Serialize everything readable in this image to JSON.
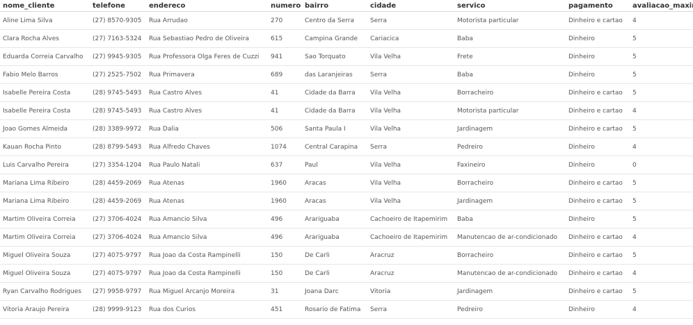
{
  "table": {
    "columns": [
      "nome_cliente",
      "telefone",
      "endereco",
      "numero",
      "bairro",
      "cidade",
      "servico",
      "pagamento",
      "avaliacao_maxima"
    ],
    "rows": [
      [
        "Aline Lima Silva",
        "(27) 8570-9305",
        "Rua Arrudao",
        "270",
        "Centro da Serra",
        "Serra",
        "Motorista particular",
        "Dinheiro e cartao",
        "4"
      ],
      [
        "Clara Rocha Alves",
        "(27) 7163-5324",
        "Rua Sebastiao Pedro de Oliveira",
        "615",
        "Campina Grande",
        "Cariacica",
        "Baba",
        "Dinheiro",
        "5"
      ],
      [
        "Eduarda Correia Carvalho",
        "(27) 9945-9305",
        "Rua Professora Olga Feres de Cuzzi",
        "941",
        "Sao Torquato",
        "Vila Velha",
        "Frete",
        "Dinheiro",
        "5"
      ],
      [
        "Fabio Melo Barros",
        "(27) 2525-7502",
        "Rua Primavera",
        "689",
        "das Laranjeiras",
        "Serra",
        "Baba",
        "Dinheiro",
        "5"
      ],
      [
        "Isabelle Pereira Costa",
        "(28) 9745-5493",
        "Rua Castro Alves",
        "41",
        "Cidade da Barra",
        "Vila Velha",
        "Borracheiro",
        "Dinheiro e cartao",
        "5"
      ],
      [
        "Isabelle Pereira Costa",
        "(28) 9745-5493",
        "Rua Castro Alves",
        "41",
        "Cidade da Barra",
        "Vila Velha",
        "Motorista particular",
        "Dinheiro e cartao",
        "4"
      ],
      [
        "Joao Gomes Almeida",
        "(28) 3389-9972",
        "Rua Dalia",
        "506",
        "Santa Paula I",
        "Vila Velha",
        "Jardinagem",
        "Dinheiro e cartao",
        "5"
      ],
      [
        "Kauan Rocha Pinto",
        "(28) 8799-5493",
        "Rua Alfredo Chaves",
        "1074",
        "Central Carapina",
        "Serra",
        "Pedreiro",
        "Dinheiro",
        "4"
      ],
      [
        "Luis Carvalho Pereira",
        "(27) 3354-1204",
        "Rua Paulo Natali",
        "637",
        "Paul",
        "Vila Velha",
        "Faxineiro",
        "Dinheiro",
        "0"
      ],
      [
        "Mariana Lima Ribeiro",
        "(28) 4459-2069",
        "Rua Atenas",
        "1960",
        "Aracas",
        "Vila Velha",
        "Borracheiro",
        "Dinheiro e cartao",
        "5"
      ],
      [
        "Mariana Lima Ribeiro",
        "(28) 4459-2069",
        "Rua Atenas",
        "1960",
        "Aracas",
        "Vila Velha",
        "Jardinagem",
        "Dinheiro e cartao",
        "5"
      ],
      [
        "Martim Oliveira Correia",
        "(27) 3706-4024",
        "Rua Amancio Silva",
        "496",
        "Arariguaba",
        "Cachoeiro de Itapemirim",
        "Baba",
        "Dinheiro",
        "5"
      ],
      [
        "Martim Oliveira Correia",
        "(27) 3706-4024",
        "Rua Amancio Silva",
        "496",
        "Arariguaba",
        "Cachoeiro de Itapemirim",
        "Manutencao de ar-condicionado",
        "Dinheiro e cartao",
        "4"
      ],
      [
        "Miguel Oliveira Souza",
        "(27) 4075-9797",
        "Rua Joao da Costa Rampinelli",
        "150",
        "De Carli",
        "Aracruz",
        "Borracheiro",
        "Dinheiro e cartao",
        "5"
      ],
      [
        "Miguel Oliveira Souza",
        "(27) 4075-9797",
        "Rua Joao da Costa Rampinelli",
        "150",
        "De Carli",
        "Aracruz",
        "Manutencao de ar-condicionado",
        "Dinheiro e cartao",
        "4"
      ],
      [
        "Ryan Carvalho Rodrigues",
        "(27) 9958-9797",
        "Rua Miguel Arcanjo Moreira",
        "31",
        "Joana Darc",
        "Vitoria",
        "Jardinagem",
        "Dinheiro e cartao",
        "5"
      ],
      [
        "Vitoria Araujo Pereira",
        "(28) 9999-9123",
        "Rua dos Curios",
        "451",
        "Rosario de Fatima",
        "Serra",
        "Pedreiro",
        "Dinheiro",
        "4"
      ]
    ]
  }
}
